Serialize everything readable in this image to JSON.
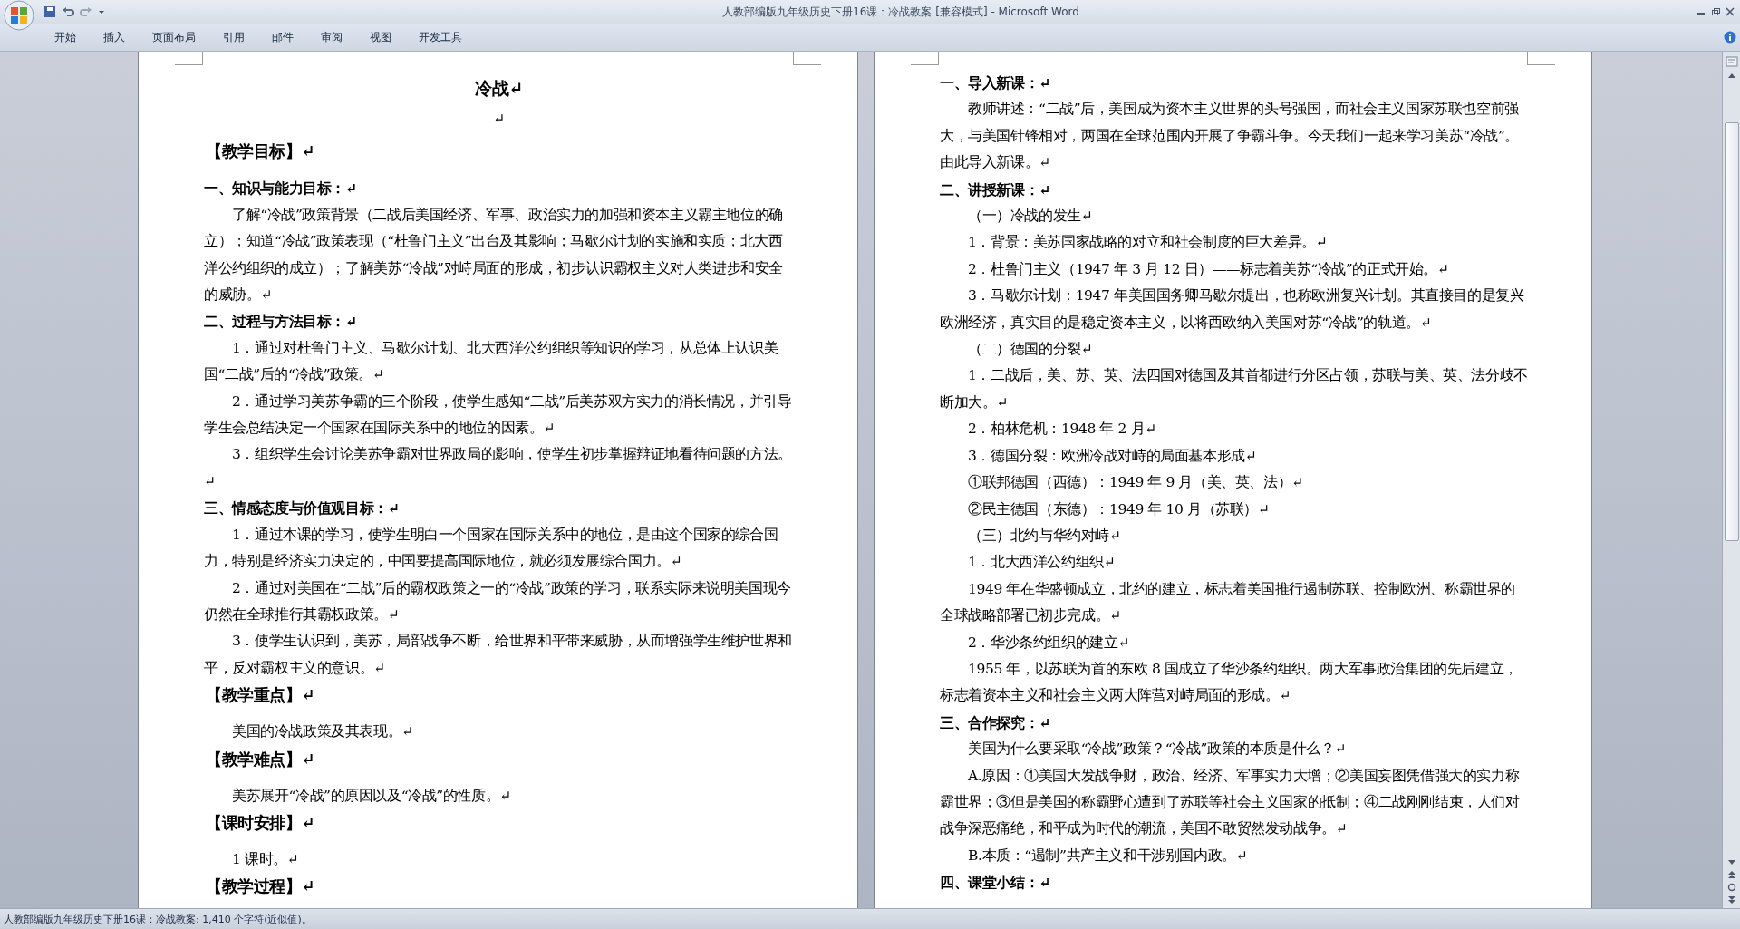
{
  "window": {
    "title": "人教部编版九年级历史下册16课：冷战教案 [兼容模式] - Microsoft Word"
  },
  "ribbon": {
    "tabs": [
      {
        "label": "开始"
      },
      {
        "label": "插入"
      },
      {
        "label": "页面布局"
      },
      {
        "label": "引用"
      },
      {
        "label": "邮件"
      },
      {
        "label": "审阅"
      },
      {
        "label": "视图"
      },
      {
        "label": "开发工具"
      }
    ]
  },
  "pages": [
    {
      "paragraphs": [
        {
          "kind": "title",
          "text": "冷战↵"
        },
        {
          "kind": "blank",
          "text": "↵"
        },
        {
          "kind": "heading",
          "text": "【教学目标】↵"
        },
        {
          "kind": "subheading",
          "text": "一、知识与能力目标：↵"
        },
        {
          "kind": "body",
          "text": "了解“冷战”政策背景（二战后美国经济、军事、政治实力的加强和资本主义霸主地位的确立）；知道“冷战”政策表现（“杜鲁门主义”出台及其影响；马歇尔计划的实施和实质；北大西洋公约组织的成立）；了解美苏“冷战”对峙局面的形成，初步认识霸权主义对人类进步和安全的威胁。↵"
        },
        {
          "kind": "subheading",
          "text": "二、过程与方法目标：↵"
        },
        {
          "kind": "body",
          "text": "1．通过对杜鲁门主义、马歇尔计划、北大西洋公约组织等知识的学习，从总体上认识美国“二战”后的“冷战”政策。↵"
        },
        {
          "kind": "body",
          "text": "2．通过学习美苏争霸的三个阶段，使学生感知“二战”后美苏双方实力的消长情况，并引导学生会总结决定一个国家在国际关系中的地位的因素。↵"
        },
        {
          "kind": "body",
          "text": "3．组织学生会讨论美苏争霸对世界政局的影响，使学生初步掌握辩证地看待问题的方法。↵"
        },
        {
          "kind": "subheading",
          "text": "三、情感态度与价值观目标：↵"
        },
        {
          "kind": "body",
          "text": "1．通过本课的学习，使学生明白一个国家在国际关系中的地位，是由这个国家的综合国力，特别是经济实力决定的，中国要提高国际地位，就必须发展综合国力。↵"
        },
        {
          "kind": "body",
          "text": "2．通过对美国在“二战”后的霸权政策之一的“冷战”政策的学习，联系实际来说明美国现今仍然在全球推行其霸权政策。↵"
        },
        {
          "kind": "body",
          "text": "3．使学生认识到，美苏，局部战争不断，给世界和平带来威胁，从而增强学生维护世界和平，反对霸权主义的意识。↵"
        },
        {
          "kind": "heading",
          "text": "【教学重点】↵"
        },
        {
          "kind": "body",
          "text": "美国的冷战政策及其表现。↵"
        },
        {
          "kind": "heading",
          "text": "【教学难点】↵"
        },
        {
          "kind": "body",
          "text": "美苏展开“冷战”的原因以及“冷战”的性质。↵"
        },
        {
          "kind": "heading",
          "text": "【课时安排】↵"
        },
        {
          "kind": "body",
          "text": "1 课时。↵"
        },
        {
          "kind": "heading",
          "text": "【教学过程】↵"
        }
      ]
    },
    {
      "paragraphs": [
        {
          "kind": "subheading",
          "text": "一、导入新课：↵"
        },
        {
          "kind": "body",
          "text": "教师讲述：“二战”后，美国成为资本主义世界的头号强国，而社会主义国家苏联也空前强大，与美国针锋相对，两国在全球范围内开展了争霸斗争。今天我们一起来学习美苏“冷战”。由此导入新课。↵"
        },
        {
          "kind": "subheading",
          "text": "二、讲授新课：↵"
        },
        {
          "kind": "body",
          "text": "（一）冷战的发生↵"
        },
        {
          "kind": "body",
          "text": "1．背景：美苏国家战略的对立和社会制度的巨大差异。↵"
        },
        {
          "kind": "body",
          "text": "2．杜鲁门主义（1947 年 3 月 12 日）——标志着美苏“冷战”的正式开始。↵"
        },
        {
          "kind": "body",
          "text": "3．马歇尔计划：1947 年美国国务卿马歇尔提出，也称欧洲复兴计划。其直接目的是复兴欧洲经济，真实目的是稳定资本主义，以将西欧纳入美国对苏“冷战”的轨道。↵"
        },
        {
          "kind": "body",
          "text": "（二）德国的分裂↵"
        },
        {
          "kind": "body",
          "text": "1．二战后，美、苏、英、法四国对德国及其首都进行分区占领，苏联与美、英、法分歧不断加大。↵"
        },
        {
          "kind": "body",
          "text": "2．柏林危机：1948 年 2 月↵"
        },
        {
          "kind": "body",
          "text": "3．德国分裂：欧洲冷战对峙的局面基本形成↵"
        },
        {
          "kind": "body",
          "text": "①联邦德国（西德）：1949 年 9 月（美、英、法）↵"
        },
        {
          "kind": "body",
          "text": "②民主德国（东德）：1949 年 10 月（苏联）↵"
        },
        {
          "kind": "body",
          "text": "（三）北约与华约对峙↵"
        },
        {
          "kind": "body",
          "text": "1．北大西洋公约组织↵"
        },
        {
          "kind": "body",
          "text": "1949 年在华盛顿成立，北约的建立，标志着美国推行遏制苏联、控制欧洲、称霸世界的全球战略部署已初步完成。↵"
        },
        {
          "kind": "body",
          "text": "2．华沙条约组织的建立↵"
        },
        {
          "kind": "body",
          "text": "1955 年，以苏联为首的东欧 8 国成立了华沙条约组织。两大军事政治集团的先后建立，标志着资本主义和社会主义两大阵营对峙局面的形成。↵"
        },
        {
          "kind": "subheading",
          "text": "三、合作探究：↵"
        },
        {
          "kind": "body",
          "text": "美国为什么要采取“冷战”政策？“冷战”政策的本质是什么？↵"
        },
        {
          "kind": "body",
          "text": "A.原因：①美国大发战争财，政治、经济、军事实力大增；②美国妄图凭借强大的实力称霸世界；③但是美国的称霸野心遭到了苏联等社会主义国家的抵制；④二战刚刚结束，人们对战争深恶痛绝，和平成为时代的潮流，美国不敢贸然发动战争。↵"
        },
        {
          "kind": "body",
          "text": "B.本质：“遏制”共产主义和干涉别国内政。↵"
        },
        {
          "kind": "subheading",
          "text": "四、课堂小结：↵"
        }
      ]
    }
  ],
  "status_bar": {
    "text": "人教部编版九年级历史下册16课：冷战教案: 1,410 个字符(近似值)。"
  }
}
